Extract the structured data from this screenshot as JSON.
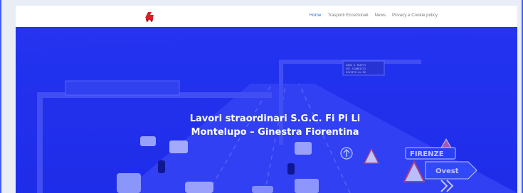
{
  "nav": {
    "items": [
      {
        "label": "Home",
        "active": true
      },
      {
        "label": "Trasporti Eccezionali",
        "active": false
      },
      {
        "label": "News",
        "active": false
      },
      {
        "label": "Privacy e Cookie policy",
        "active": false
      }
    ]
  },
  "hero": {
    "title_line1": "Lavori straordinari S.G.C. Fi Pi Li",
    "title_line2": "Montelupo – Ginestra Fiorentina",
    "overlay_color": "#1d2cf2",
    "sign_texts": {
      "gantry": "CODE A TRATTI\nSGC SCANDICCI\nDIVIETO AL MS",
      "city": "FIRENZE",
      "direction": "Ovest"
    }
  },
  "brand": {
    "logo_icon": "red-truck-logo-icon",
    "accent": "#2f6de1"
  }
}
